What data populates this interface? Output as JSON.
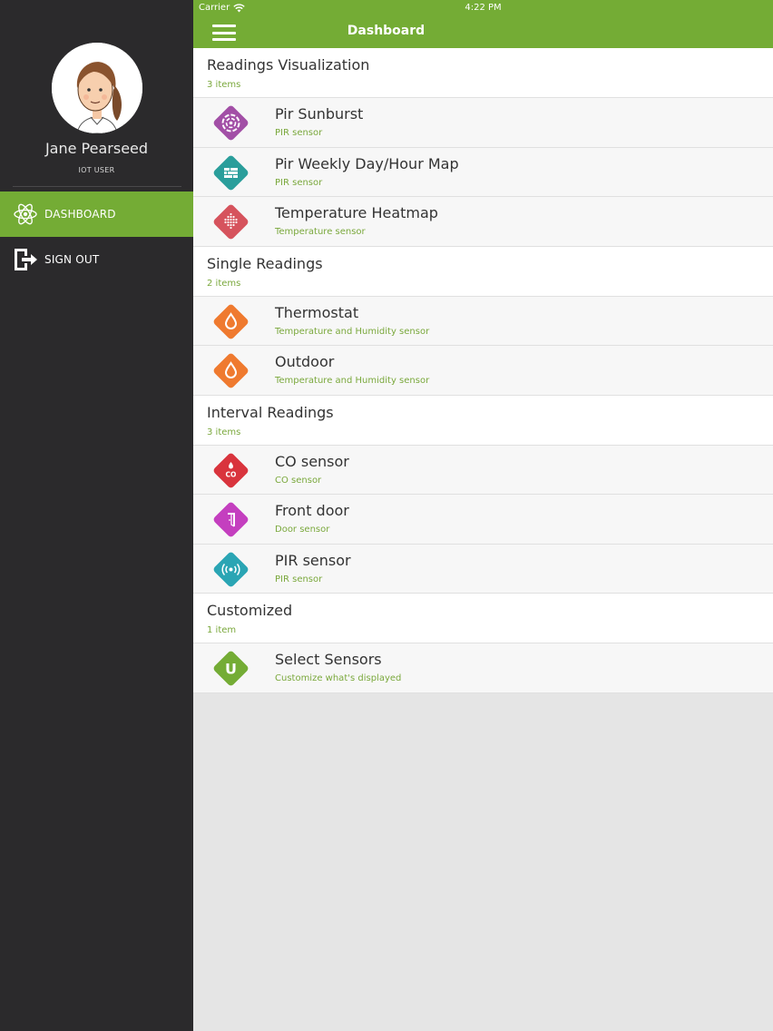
{
  "status_bar": {
    "carrier": "Carrier",
    "time": "4:22 PM"
  },
  "header": {
    "title": "Dashboard",
    "menu_icon": "hamburger-icon"
  },
  "user": {
    "name": "Jane Pearseed",
    "role": "IOT USER"
  },
  "sidebar": {
    "items": [
      {
        "label": "DASHBOARD",
        "icon": "atom-icon",
        "active": true
      },
      {
        "label": "SIGN OUT",
        "icon": "sign-out-icon",
        "active": false
      }
    ]
  },
  "sections": [
    {
      "title": "Readings Visualization",
      "count": "3 items",
      "items": [
        {
          "title": "Pir Sunburst",
          "subtitle": "PIR sensor",
          "icon": "sunburst-icon",
          "color": "#a24fa6"
        },
        {
          "title": "Pir Weekly Day/Hour Map",
          "subtitle": "PIR sensor",
          "icon": "grid-map-icon",
          "color": "#2a9e9b"
        },
        {
          "title": "Temperature Heatmap",
          "subtitle": "Temperature sensor",
          "icon": "heatmap-dots-icon",
          "color": "#d6535d"
        }
      ]
    },
    {
      "title": "Single Readings",
      "count": "2 items",
      "items": [
        {
          "title": "Thermostat",
          "subtitle": "Temperature and Humidity sensor",
          "icon": "droplet-icon",
          "color": "#ef7a2f"
        },
        {
          "title": "Outdoor",
          "subtitle": "Temperature and Humidity sensor",
          "icon": "droplet-icon",
          "color": "#ef7a2f"
        }
      ]
    },
    {
      "title": "Interval Readings",
      "count": "3 items",
      "items": [
        {
          "title": "CO sensor",
          "subtitle": "CO sensor",
          "icon": "co-flame-icon",
          "color": "#d9343d"
        },
        {
          "title": "Front door",
          "subtitle": "Door sensor",
          "icon": "door-icon",
          "color": "#c43fbf"
        },
        {
          "title": "PIR sensor",
          "subtitle": "PIR sensor",
          "icon": "radio-waves-icon",
          "color": "#2aa5b4"
        }
      ]
    },
    {
      "title": "Customized",
      "count": "1 item",
      "items": [
        {
          "title": "Select Sensors",
          "subtitle": "Customize what's displayed",
          "icon": "u-letter-icon",
          "color": "#74ac35"
        }
      ]
    }
  ],
  "colors": {
    "accent": "#74ac35",
    "sidebar_bg": "#2b2a2c",
    "subtitle": "#7aa83c"
  },
  "icon_glyphs": {
    "co_label": "CO",
    "u_label": "U"
  }
}
